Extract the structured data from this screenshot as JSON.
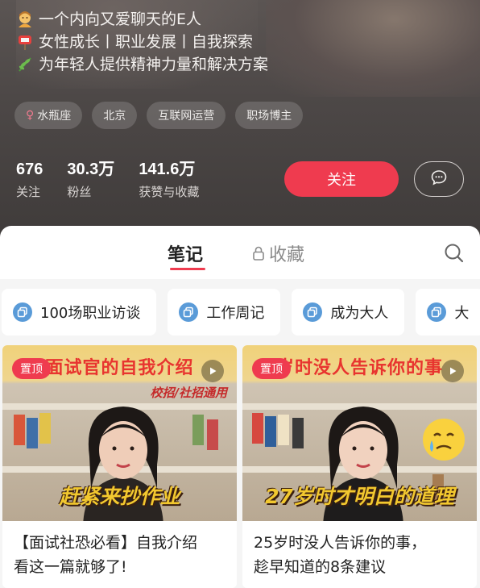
{
  "profile": {
    "bio": [
      {
        "icon": "woman-emoji-icon",
        "text": "一个内向又爱聊天的E人"
      },
      {
        "icon": "mailbox-emoji-icon",
        "text": "女性成长丨职业发展丨自我探索"
      },
      {
        "icon": "herb-emoji-icon",
        "text": "为年轻人提供精神力量和解决方案"
      }
    ],
    "tags": [
      "水瓶座",
      "北京",
      "互联网运营",
      "职场博主"
    ],
    "stats": [
      {
        "value": "676",
        "label": "关注"
      },
      {
        "value": "30.3万",
        "label": "粉丝"
      },
      {
        "value": "141.6万",
        "label": "获赞与收藏"
      }
    ],
    "follow_label": "关注"
  },
  "tabs": {
    "notes": "笔记",
    "collections": "收藏"
  },
  "collections_chips": [
    "100场职业访谈",
    "工作周记",
    "成为大人",
    "大"
  ],
  "notes": [
    {
      "badge": "置顶",
      "cover_headline": "面试官的自我介绍",
      "cover_subline": "校招/社招通用",
      "cover_caption": "赶紧来抄作业",
      "title_line1": "【面试社恐必看】自我介绍",
      "title_line2": "看这一篇就够了!"
    },
    {
      "badge": "置顶",
      "cover_headline": "岁时没人告诉你的事",
      "cover_caption": "27岁时才明白的道理",
      "title_line1": "25岁时没人告诉你的事，",
      "title_line2": "趁早知道的8条建议"
    }
  ],
  "colors": {
    "accent": "#ef3b4f",
    "header_bg": "#4d4847",
    "chip_icon": "#5a9bd8"
  }
}
